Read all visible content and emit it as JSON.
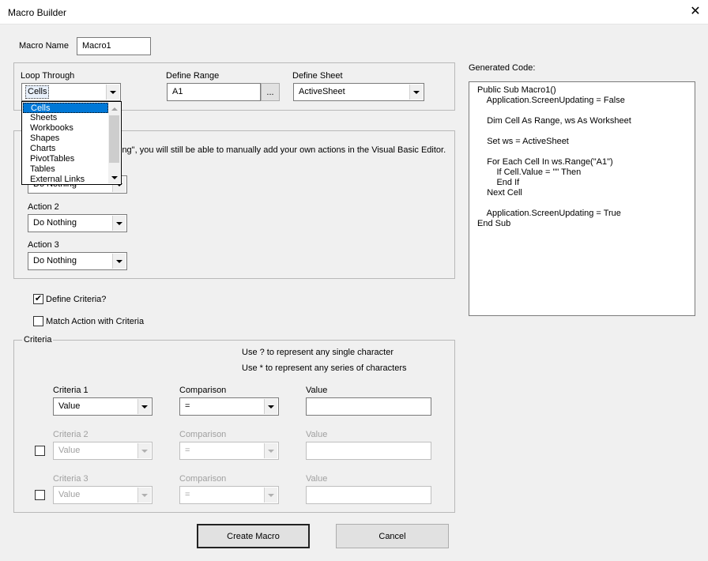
{
  "window": {
    "title": "Macro Builder",
    "close_glyph": "✕"
  },
  "macro_name": {
    "label": "Macro Name",
    "value": "Macro1"
  },
  "loop": {
    "loop_through_label": "Loop Through",
    "loop_through_value": "Cells",
    "define_range_label": "Define Range",
    "define_range_value": "A1",
    "ellipsis_label": "...",
    "define_sheet_label": "Define Sheet",
    "define_sheet_value": "ActiveSheet"
  },
  "loop_dropdown": {
    "options": [
      "Cells",
      "Sheets",
      "Workbooks",
      "Shapes",
      "Charts",
      "PivotTables",
      "Tables",
      "External Links"
    ],
    "selected_index": 0
  },
  "actions": {
    "note_text": "ing\", you will still be able to manually add your own actions in the Visual Basic Editor.",
    "action1_value": "Do Nothing",
    "action2_label": "Action 2",
    "action2_value": "Do Nothing",
    "action3_label": "Action 3",
    "action3_value": "Do Nothing"
  },
  "options": {
    "define_criteria_label": "Define Criteria?",
    "define_criteria_checked": true,
    "check_glyph": "✔",
    "match_action_label": "Match Action with Criteria",
    "match_action_checked": false
  },
  "criteria": {
    "legend": "Criteria",
    "hint1": "Use ? to represent any single character",
    "hint2": "Use * to represent any series of characters",
    "rows": [
      {
        "criteria_label": "Criteria 1",
        "criteria_value": "Value",
        "comparison_label": "Comparison",
        "comparison_value": "=",
        "value_label": "Value",
        "value": "",
        "enabled": true
      },
      {
        "criteria_label": "Criteria 2",
        "criteria_value": "Value",
        "comparison_label": "Comparison",
        "comparison_value": "=",
        "value_label": "Value",
        "value": "",
        "enabled": false
      },
      {
        "criteria_label": "Criteria 3",
        "criteria_value": "Value",
        "comparison_label": "Comparison",
        "comparison_value": "=",
        "value_label": "Value",
        "value": "",
        "enabled": false
      }
    ]
  },
  "code": {
    "label": "Generated Code:",
    "lines": [
      "Public Sub Macro1()",
      "    Application.ScreenUpdating = False",
      "",
      "    Dim Cell As Range, ws As Worksheet",
      "",
      "    Set ws = ActiveSheet",
      "",
      "    For Each Cell In ws.Range(\"A1\")",
      "        If Cell.Value = \"\" Then",
      "        End If",
      "    Next Cell",
      "",
      "    Application.ScreenUpdating = True",
      "End Sub"
    ]
  },
  "buttons": {
    "create_label": "Create Macro",
    "cancel_label": "Cancel"
  },
  "colors": {
    "selection": "#0078d7",
    "background": "#f0f0f0",
    "disabled_text": "#a0a0a0"
  }
}
